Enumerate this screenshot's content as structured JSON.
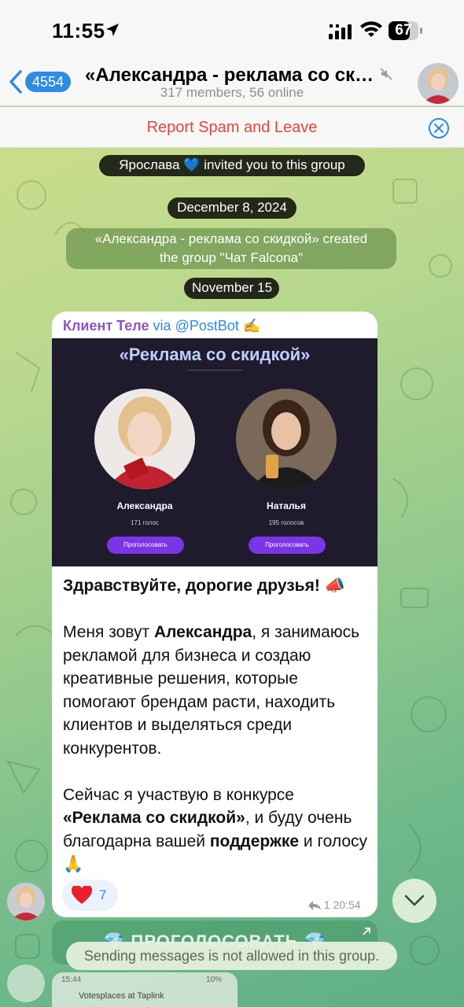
{
  "status_bar": {
    "time": "11:55",
    "battery": "67"
  },
  "header": {
    "back_count": "4554",
    "title": "«Александра - реклама со ски...",
    "subtitle": "317 members, 56 online"
  },
  "spam_bar": {
    "text": "Report Spam and Leave"
  },
  "service": {
    "invite": "Ярослава 💙 invited you to this group",
    "date1": "December 8, 2024",
    "created_line1": "«Александра - реклама со скидкой» created",
    "created_line2": "the group \"Чат Falcona\"",
    "date2": "November 15"
  },
  "message": {
    "sender_name": "Клиент Теле",
    "via": "via",
    "bot": "@PostBot",
    "bot_emoji": "✍️",
    "promo": {
      "title": "«Реклама со скидкой»",
      "candidates": [
        {
          "name": "Александра",
          "votes": "171 голос",
          "button": "Проголосовать"
        },
        {
          "name": "Наталья",
          "votes": "195 голосов",
          "button": "Проголосовать"
        }
      ]
    },
    "text": {
      "greeting": "Здравствуйте, дорогие друзья! 📣",
      "p1_a": "Меня зовут ",
      "p1_name": "Александра",
      "p1_b": ", я занимаюсь рекламой для бизнеса и создаю креативные решения, которые помогают брендам расти, находить клиентов и выделяться среди конкурентов.",
      "p2_a": "Сейчас я участвую в конкурсе ",
      "p2_contest": "«Реклама со скидкой»",
      "p2_b": ", и буду очень благодарна вашей ",
      "p2_support": "поддержке",
      "p2_c": " и голосу 🙏"
    },
    "reaction_count": "7",
    "reply_count": "1",
    "time": "20:54"
  },
  "inline_button": {
    "label": "💎 ПРОГОЛОСОВАТЬ 💎"
  },
  "next_message": {
    "status_time": "15:44",
    "battery": "10%",
    "line": "Votesplaces at Taplink"
  },
  "toast": "Sending messages is not allowed in this group.",
  "colors": {
    "accent": "#2f8ae4",
    "danger": "#e8443b",
    "sender": "#8a56c8",
    "vote_button": "#7a35e6"
  }
}
